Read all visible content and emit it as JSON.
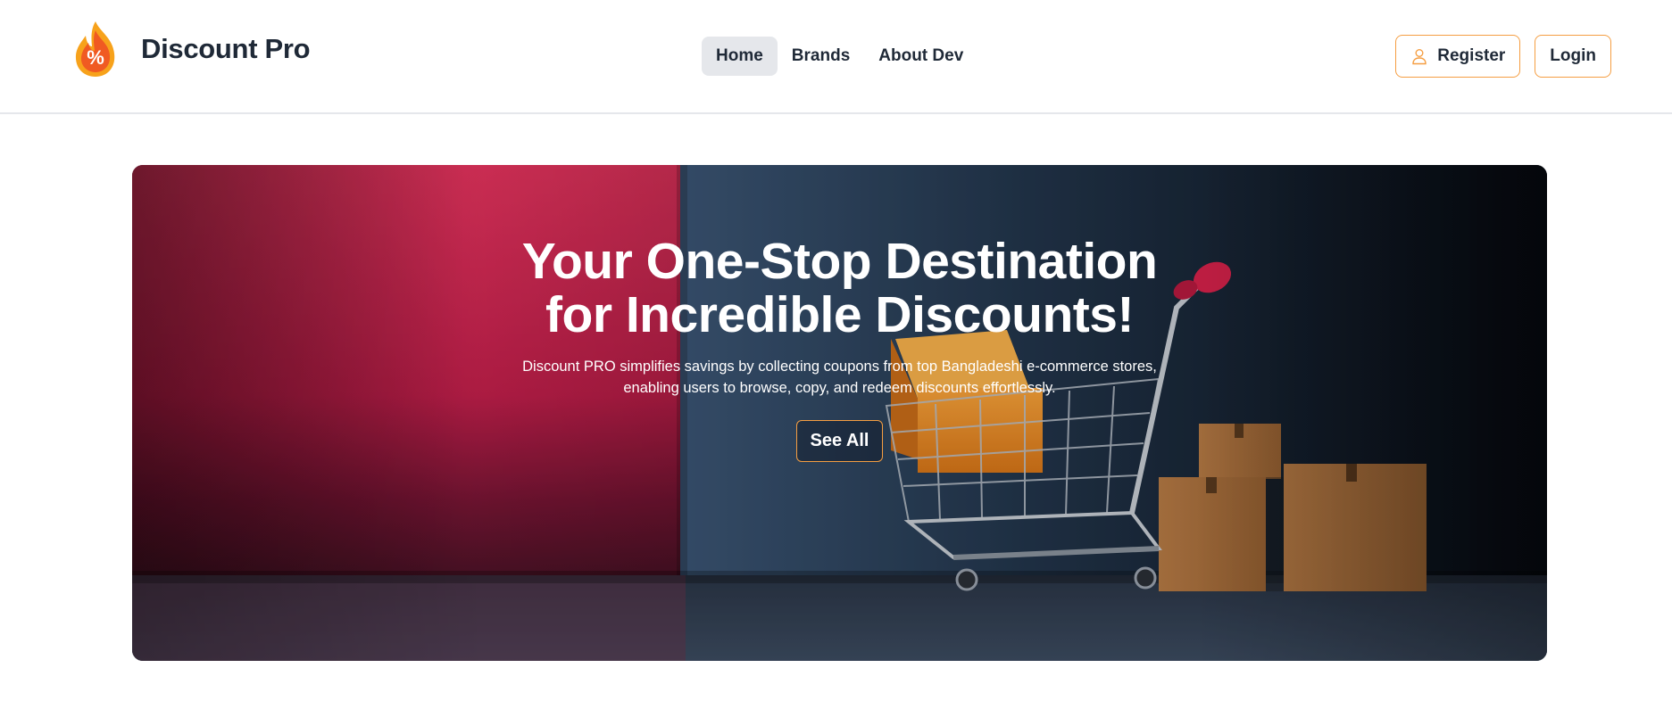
{
  "brand": {
    "logo_icon": "flame-percent-icon",
    "name": "Discount Pro"
  },
  "nav": {
    "links": [
      {
        "label": "Home",
        "active": true
      },
      {
        "label": "Brands",
        "active": false
      },
      {
        "label": "About Dev",
        "active": false
      }
    ]
  },
  "auth": {
    "register_label": "Register",
    "register_icon": "user-icon",
    "login_label": "Login"
  },
  "hero": {
    "title": "Your One-Stop Destination for Incredible Discounts!",
    "description": "Discount PRO simplifies savings by collecting coupons from top Bangladeshi e-commerce stores, enabling users to browse, copy, and redeem discounts effortlessly.",
    "cta_label": "See All",
    "image": "shopping-cart-with-boxes"
  },
  "colors": {
    "accent": "#f59e42",
    "hero_pink": "#e3325e",
    "hero_navy": "#1b2a3c",
    "text_dark": "#1f2937",
    "nav_active_bg": "#e5e7eb"
  }
}
